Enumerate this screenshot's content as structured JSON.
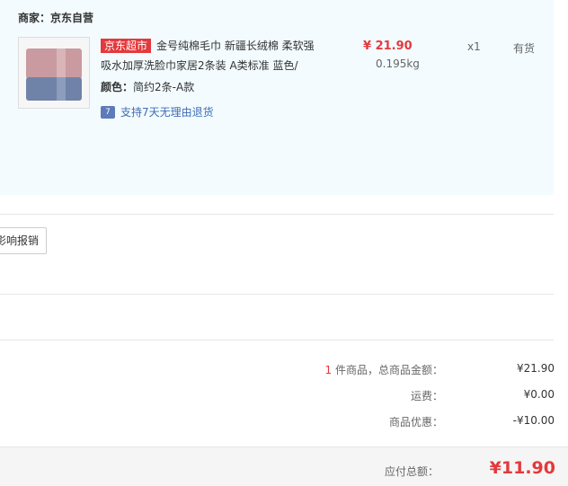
{
  "order": {
    "merchant": "商家：京东自营",
    "item": {
      "badge": "京东超市",
      "title": "金号纯棉毛巾 新疆长绒棉 柔软强吸水加厚洗脸巾家居2条装 A类标准 蓝色/",
      "price": "¥ 21.90",
      "weight": "0.195kg",
      "quantity": "x1",
      "stock": "有货",
      "color_label": "颜色：",
      "color_value": "简约2条-A款",
      "return_policy": "支持7天无理由退货",
      "return_icon_glyph": "7"
    }
  },
  "reimburse_button": "影响报销",
  "summary": {
    "count": "1",
    "count_label": " 件商品，总商品金额：",
    "subtotal": "¥21.90",
    "shipping_label": "运费：",
    "shipping": "¥0.00",
    "discount_label": "商品优惠：",
    "discount": "-¥10.00",
    "total_label": "应付总额：",
    "total": "¥11.90"
  },
  "colors": {
    "accent_red": "#e4393c",
    "link_blue": "#3f6db3",
    "panel_bg": "#f3fbfe"
  }
}
